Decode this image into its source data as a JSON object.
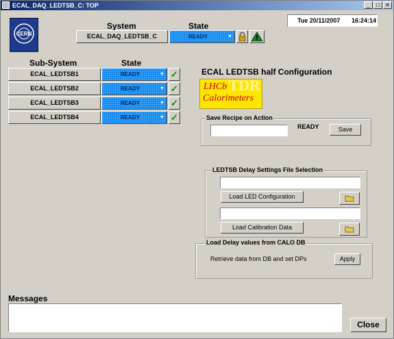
{
  "window": {
    "title": "ECAL_DAQ_LEDTSB_C: TOP",
    "minimize_glyph": "_",
    "maximize_glyph": "□",
    "close_glyph": "✕"
  },
  "datetime": {
    "date": "Tue  20/11/2007",
    "time": "16:24:14"
  },
  "system": {
    "header": "System",
    "state_header": "State",
    "name": "ECAL_DAQ_LEDTSB_C",
    "state": "READY",
    "lock_icon": "lock-icon",
    "warning_icon": "warning-icon"
  },
  "subsystems": {
    "header": "Sub-System",
    "state_header": "State",
    "items": [
      {
        "name": "ECAL_LEDTSB1",
        "state": "READY",
        "check": "✓"
      },
      {
        "name": "ECAL_LEDTSB2",
        "state": "READY",
        "check": "✓"
      },
      {
        "name": "ECAL_LEDTSB3",
        "state": "READY",
        "check": "✓"
      },
      {
        "name": "ECAL_LEDTSB4",
        "state": "READY",
        "check": "✓"
      }
    ]
  },
  "config": {
    "title": "ECAL LEDTSB half Configuration",
    "logo_line1": "LHCb",
    "logo_line2": "Calorimeters",
    "logo_watermark": "TDR"
  },
  "recipe": {
    "legend": "Save Recipe on Action",
    "input_value": "",
    "status": "READY",
    "save_label": "Save"
  },
  "delay_file": {
    "legend": "LEDTSB Delay Settings File Selection",
    "led_path": "",
    "load_led_label": "Load LED Configuration",
    "calib_path": "",
    "load_calib_label": "Load Calibration Data",
    "folder_icon": "folder-icon"
  },
  "calo_db": {
    "legend": "Load Delay values from CALO DB",
    "description": "Retrieve data from DB and set DPs",
    "apply_label": "Apply"
  },
  "messages": {
    "label": "Messages",
    "content": ""
  },
  "close_label": "Close"
}
